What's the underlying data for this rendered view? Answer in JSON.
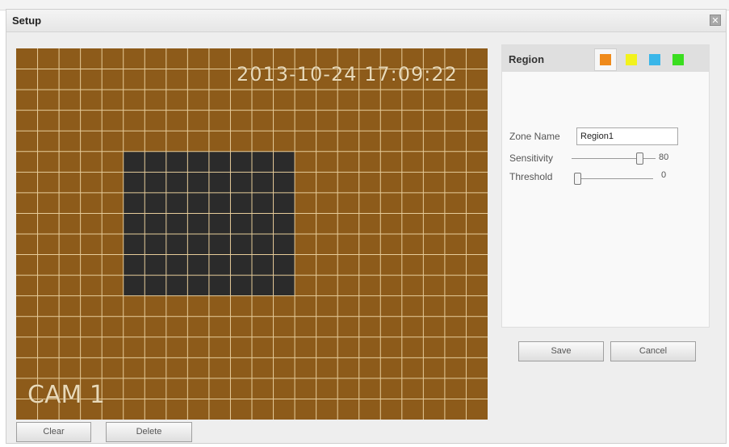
{
  "dialog": {
    "title": "Setup",
    "close_glyph": "✕"
  },
  "video": {
    "timestamp": "2013-10-24 17:09:22",
    "camera_name": "CAM 1",
    "background_color": "#8d5b1a",
    "grid_color": "#e6cc9a",
    "selected_color": "#2b2b2b",
    "grid_cols": 22,
    "grid_rows": 18,
    "selected_cols": [
      5,
      12
    ],
    "selected_rows": [
      5,
      11
    ]
  },
  "buttons": {
    "clear": "Clear",
    "delete": "Delete",
    "save": "Save",
    "cancel": "Cancel"
  },
  "panel": {
    "region_label": "Region",
    "region_colors": [
      "#ef8a1b",
      "#f2f21c",
      "#39b6e9",
      "#3ade20"
    ],
    "selected_color_index": 0,
    "zone_name_label": "Zone Name",
    "zone_name_value": "Region1",
    "sensitivity_label": "Sensitivity",
    "sensitivity_value": "80",
    "threshold_label": "Threshold",
    "threshold_value": "0"
  }
}
